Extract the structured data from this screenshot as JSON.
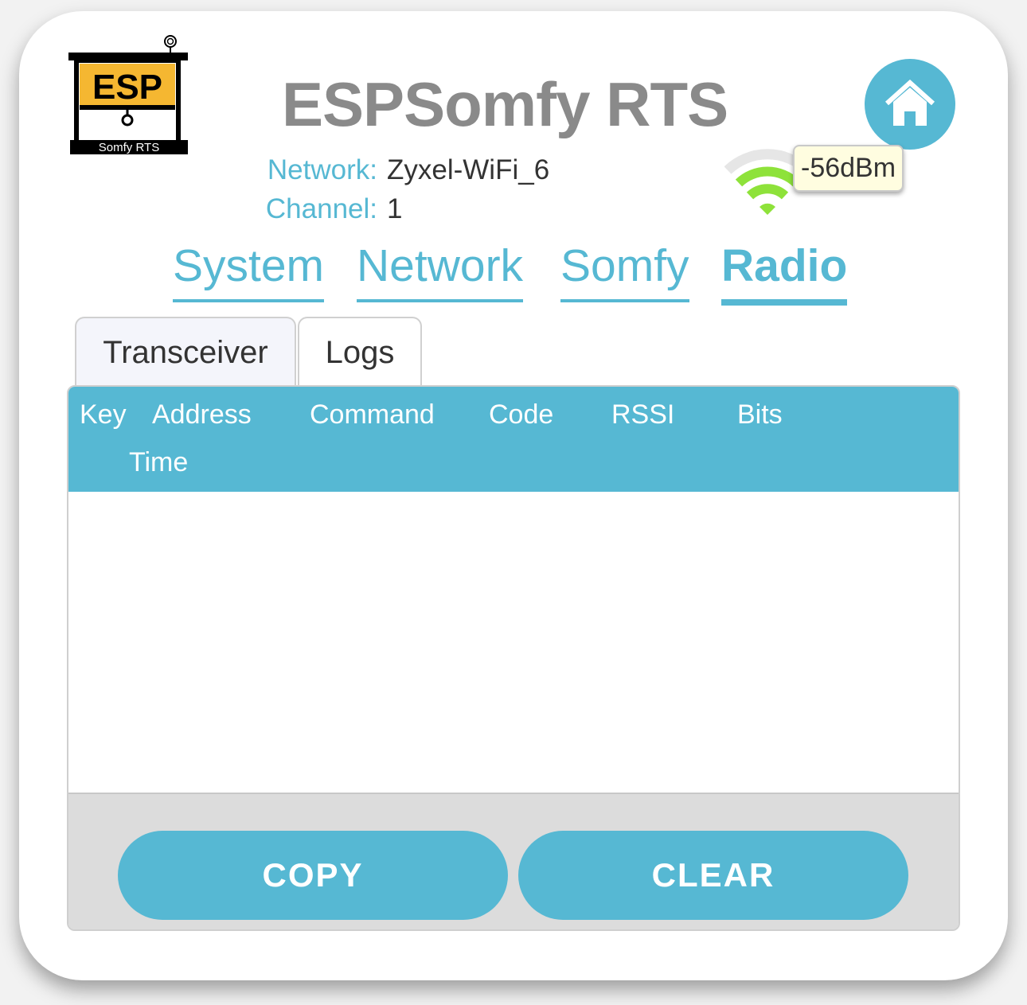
{
  "header": {
    "title": "ESPSomfy RTS",
    "logo": {
      "top_text": "ESP",
      "bottom_text": "Somfy RTS"
    }
  },
  "network": {
    "network_label": "Network:",
    "network_value": "Zyxel-WiFi_6",
    "channel_label": "Channel:",
    "channel_value": "1",
    "rssi": "-56dBm"
  },
  "main_tabs": [
    {
      "label": "System"
    },
    {
      "label": "Network"
    },
    {
      "label": "Somfy"
    },
    {
      "label": "Radio",
      "active": true
    }
  ],
  "sub_tabs": [
    {
      "label": "Transceiver",
      "active": true
    },
    {
      "label": "Logs"
    }
  ],
  "table": {
    "columns": [
      "Key",
      "Address",
      "Command",
      "Code",
      "RSSI",
      "Bits",
      "Time"
    ],
    "rows": []
  },
  "buttons": {
    "copy": "COPY",
    "clear": "CLEAR"
  },
  "colors": {
    "accent": "#56b8d3",
    "title_gray": "#8a8a8a",
    "wifi_green": "#8ee23a",
    "logo_yellow": "#f5b731"
  }
}
